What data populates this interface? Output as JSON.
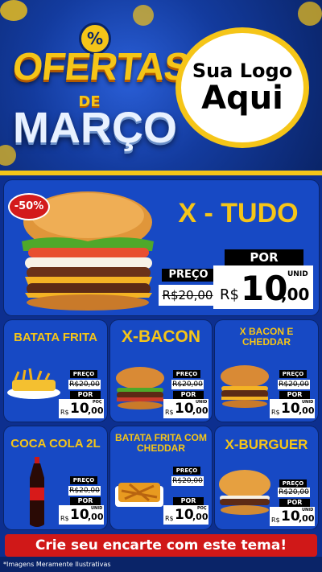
{
  "header": {
    "badge_symbol": "%",
    "title_line1": "OFERTAS",
    "title_line2": "DE",
    "title_line3": "MARÇO",
    "logo_line1": "Sua Logo",
    "logo_line2": "Aqui"
  },
  "featured": {
    "discount": "-50%",
    "name": "X - TUDO",
    "old_label": "PREÇO",
    "old_price": "R$20,00",
    "new_label": "POR",
    "unit": "UNID",
    "currency": "R$",
    "price_int": "10",
    "price_cents": ",00"
  },
  "products": [
    {
      "name": "BATATA FRITA",
      "old_label": "PREÇO",
      "old_price": "R$20,00",
      "new_label": "POR",
      "unit": "POÇ",
      "currency": "R$",
      "price_int": "10",
      "price_cents": ",00"
    },
    {
      "name": "X-BACON",
      "old_label": "PREÇO",
      "old_price": "R$20,00",
      "new_label": "POR",
      "unit": "UNID",
      "currency": "R$",
      "price_int": "10",
      "price_cents": ",00"
    },
    {
      "name": "X BACON E CHEDDAR",
      "old_label": "PREÇO",
      "old_price": "R$20,00",
      "new_label": "POR",
      "unit": "UNID",
      "currency": "R$",
      "price_int": "10",
      "price_cents": ",00"
    },
    {
      "name": "COCA COLA 2L",
      "old_label": "PREÇO",
      "old_price": "R$20,00",
      "new_label": "POR",
      "unit": "UNID",
      "currency": "R$",
      "price_int": "10",
      "price_cents": ",00"
    },
    {
      "name": "BATATA FRITA COM CHEDDAR",
      "old_label": "PREÇO",
      "old_price": "R$20,00",
      "new_label": "POR",
      "unit": "POÇ",
      "currency": "R$",
      "price_int": "10",
      "price_cents": ",00"
    },
    {
      "name": "X-BURGUER",
      "old_label": "PREÇO",
      "old_price": "R$20,00",
      "new_label": "POR",
      "unit": "UNID",
      "currency": "R$",
      "price_int": "10",
      "price_cents": ",00"
    }
  ],
  "footer": {
    "cta": "Crie seu encarte com este tema!",
    "disclaimer": "*Imagens Meramente Ilustrativas"
  },
  "colors": {
    "accent": "#f5c518",
    "brand": "#1749c4",
    "alert": "#d01818"
  }
}
